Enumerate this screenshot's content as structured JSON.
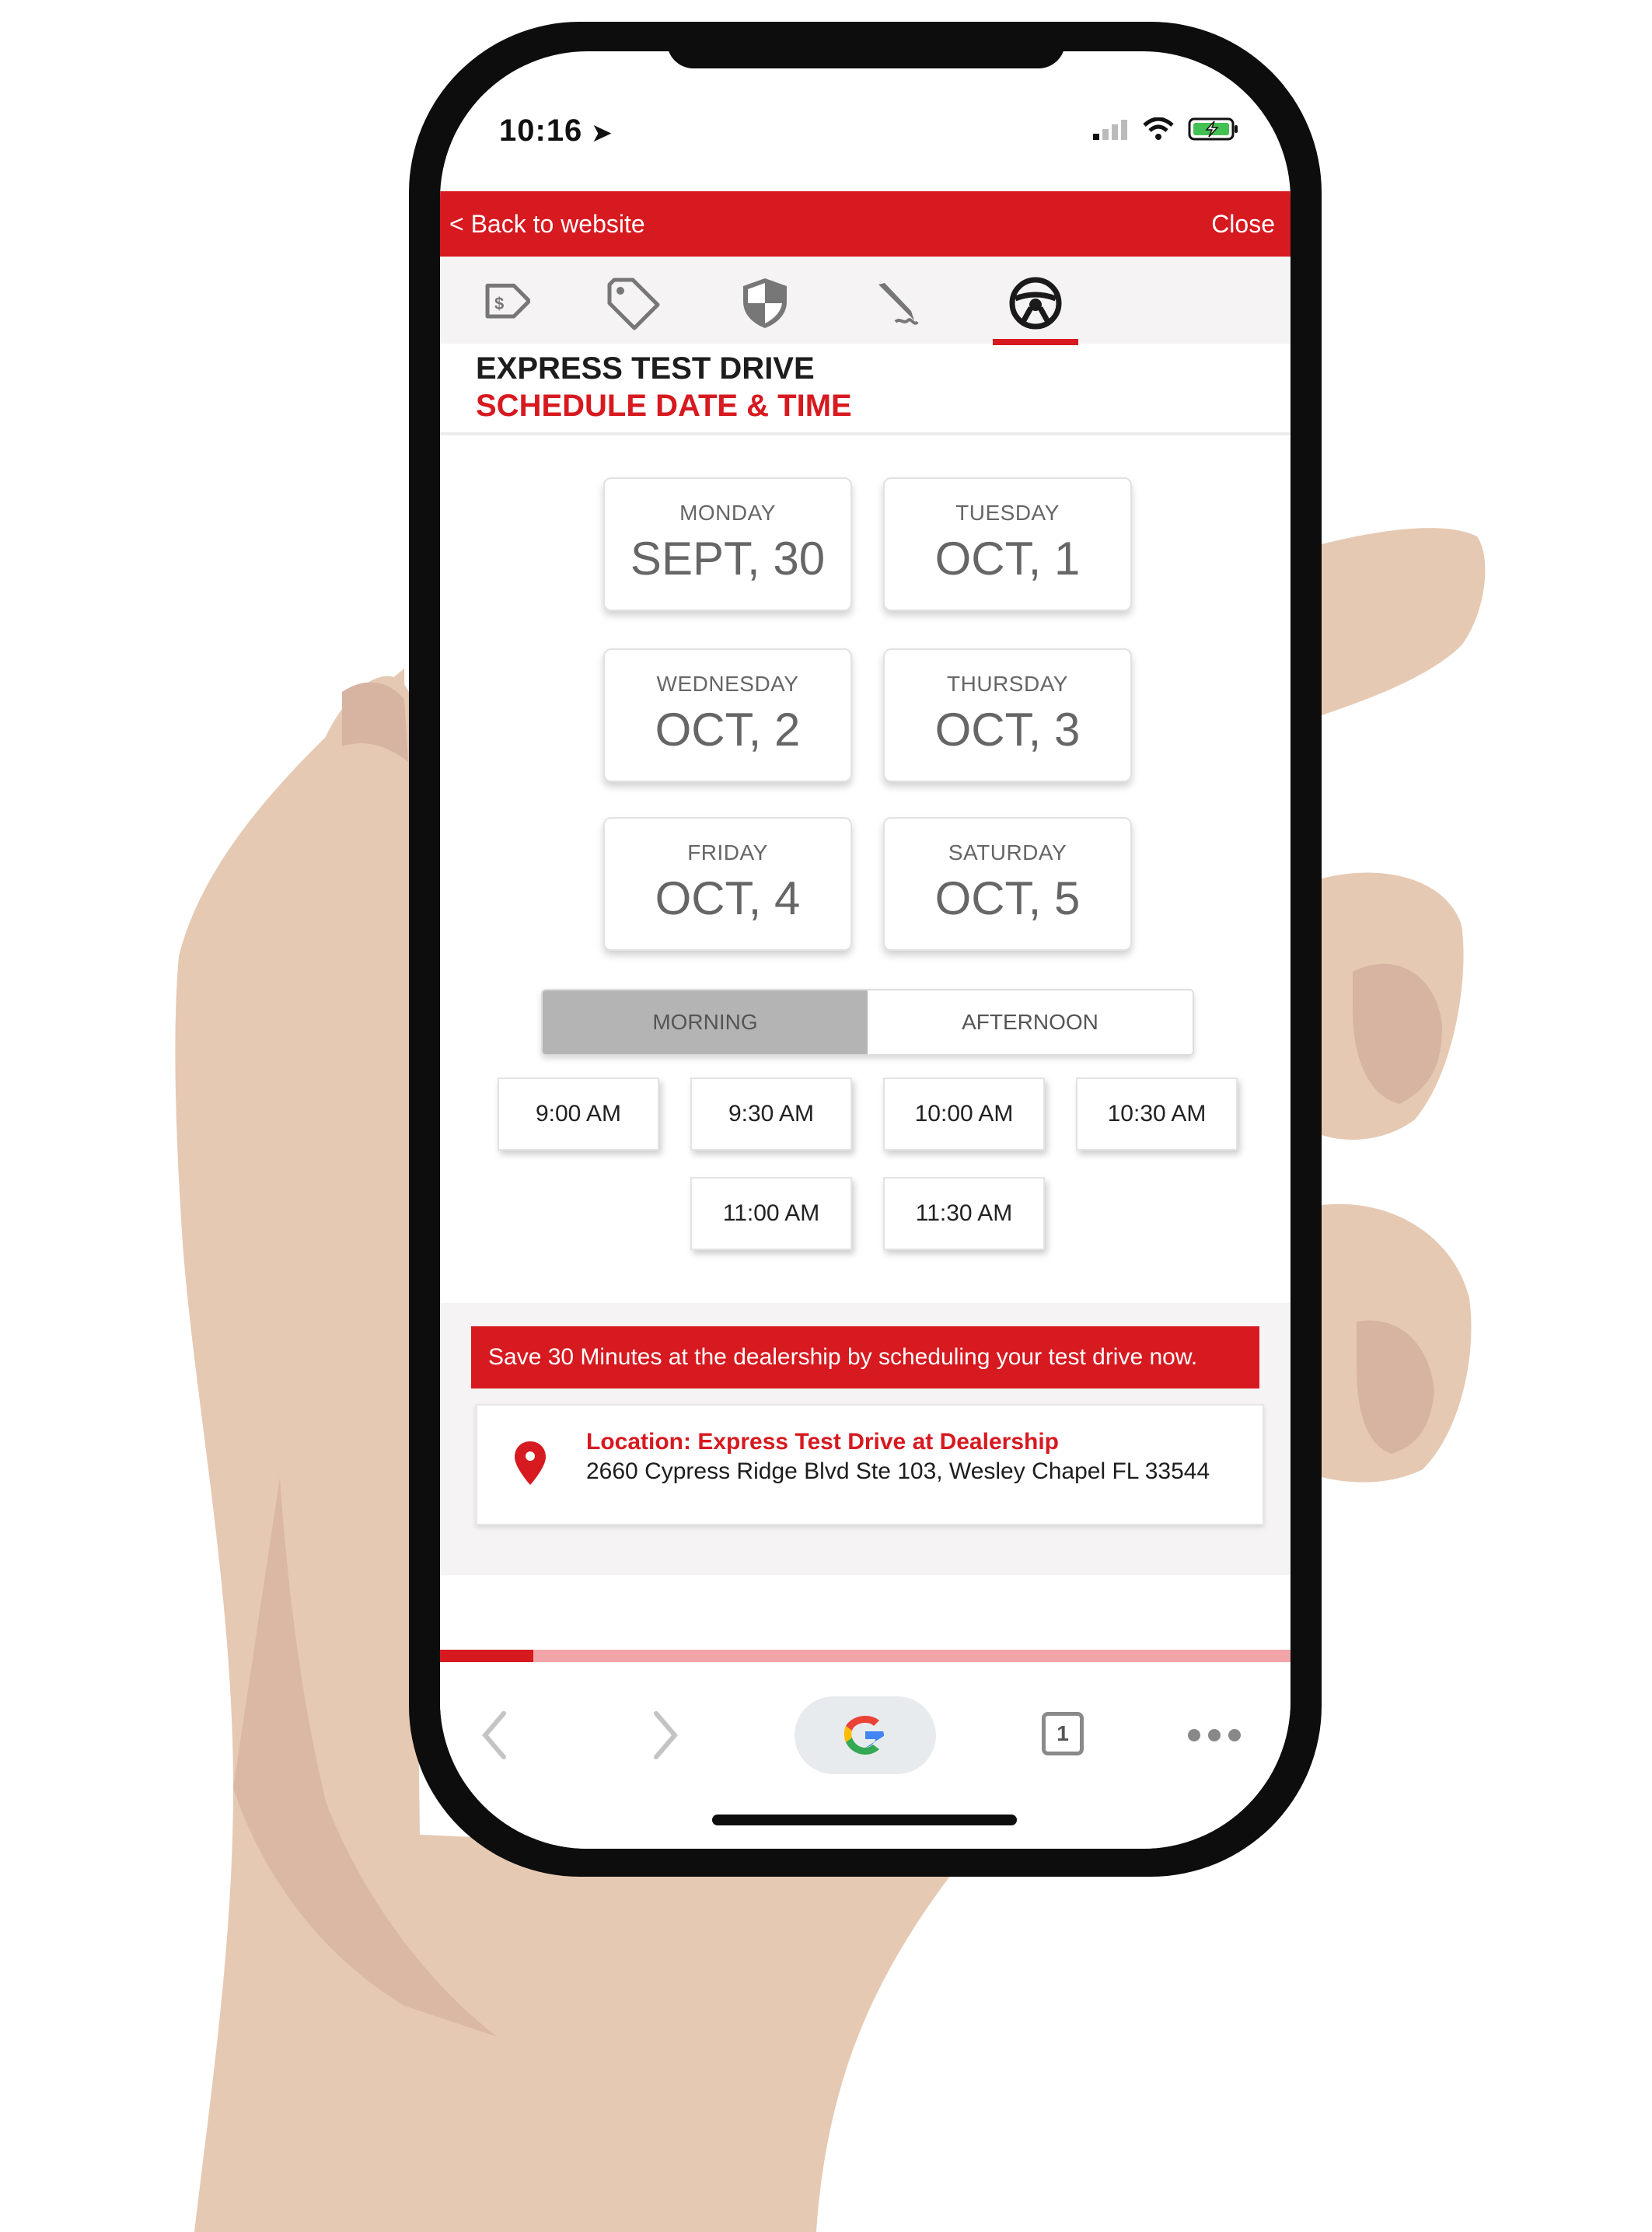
{
  "status_bar": {
    "time": "10:16",
    "location_icon": "location-arrow-icon",
    "signal_icon": "signal-icon",
    "wifi_icon": "wifi-icon",
    "battery_icon": "battery-charging-icon"
  },
  "top_bar": {
    "back_label": "< Back to website",
    "close_label": "Close",
    "color": "#d71920"
  },
  "steps": {
    "icons": [
      "price-tag-dollar-icon",
      "tag-icon",
      "shield-icon",
      "pen-signature-icon",
      "steering-wheel-icon"
    ],
    "active_index": 4
  },
  "heading": {
    "title": "EXPRESS TEST DRIVE",
    "subtitle": "SCHEDULE DATE &  TIME"
  },
  "days": [
    {
      "weekday": "MONDAY",
      "date": "SEPT, 30"
    },
    {
      "weekday": "TUESDAY",
      "date": "OCT, 1"
    },
    {
      "weekday": "WEDNESDAY",
      "date": "OCT, 2"
    },
    {
      "weekday": "THURSDAY",
      "date": "OCT, 3"
    },
    {
      "weekday": "FRIDAY",
      "date": "OCT, 4"
    },
    {
      "weekday": "SATURDAY",
      "date": "OCT, 5"
    }
  ],
  "period": {
    "morning_label": "MORNING",
    "afternoon_label": "AFTERNOON",
    "selected": "MORNING"
  },
  "times": [
    "9:00 AM",
    "9:30 AM",
    "10:00 AM",
    "10:30 AM",
    "11:00 AM",
    "11:30 AM"
  ],
  "promo": {
    "text": "Save 30 Minutes at the dealership by scheduling your test drive now."
  },
  "location": {
    "title": "Location: Express Test Drive at Dealership",
    "address": "2660 Cypress Ridge Blvd Ste 103, Wesley Chapel FL 33544",
    "icon": "map-pin-icon"
  },
  "progress": {
    "fraction": 0.11
  },
  "browser": {
    "tab_count": "1",
    "back_icon": "chevron-left-icon",
    "forward_icon": "chevron-right-icon",
    "search_icon": "google-icon",
    "tabs_icon": "tabs-icon",
    "menu_icon": "more-dots-icon"
  }
}
